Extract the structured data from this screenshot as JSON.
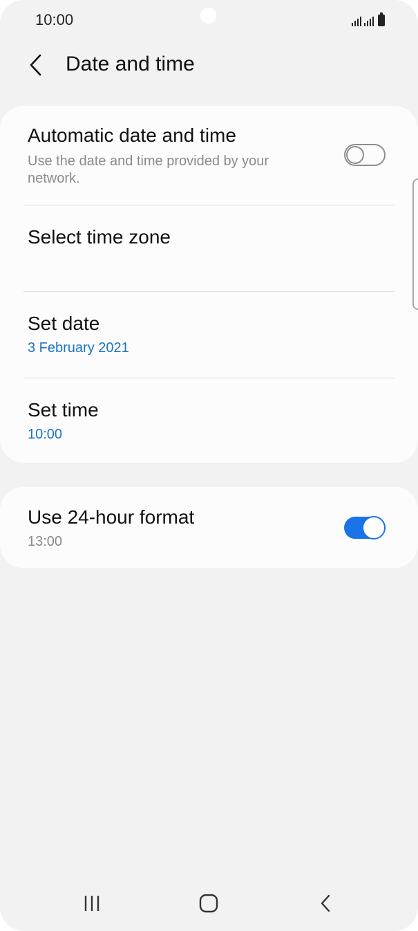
{
  "status_bar": {
    "time": "10:00",
    "icons": [
      "signal-icon",
      "signal-icon",
      "battery-icon"
    ]
  },
  "header": {
    "back_icon": "chevron-left-icon",
    "title": "Date and time"
  },
  "settings": {
    "automatic": {
      "title": "Automatic date and time",
      "subtitle": "Use the date and time provided by your network.",
      "enabled": false
    },
    "time_zone": {
      "title": "Select time zone"
    },
    "set_date": {
      "title": "Set date",
      "value": "3 February 2021"
    },
    "set_time": {
      "title": "Set time",
      "value": "10:00"
    },
    "format_24h": {
      "title": "Use 24-hour format",
      "value": "13:00",
      "enabled": true
    }
  },
  "colors": {
    "accent": "#1a73e8",
    "value_text": "#1a73c8",
    "background": "#f2f2f2",
    "card": "#fcfcfc"
  },
  "nav_bar": {
    "buttons": [
      "recents-icon",
      "home-icon",
      "back-icon"
    ]
  }
}
